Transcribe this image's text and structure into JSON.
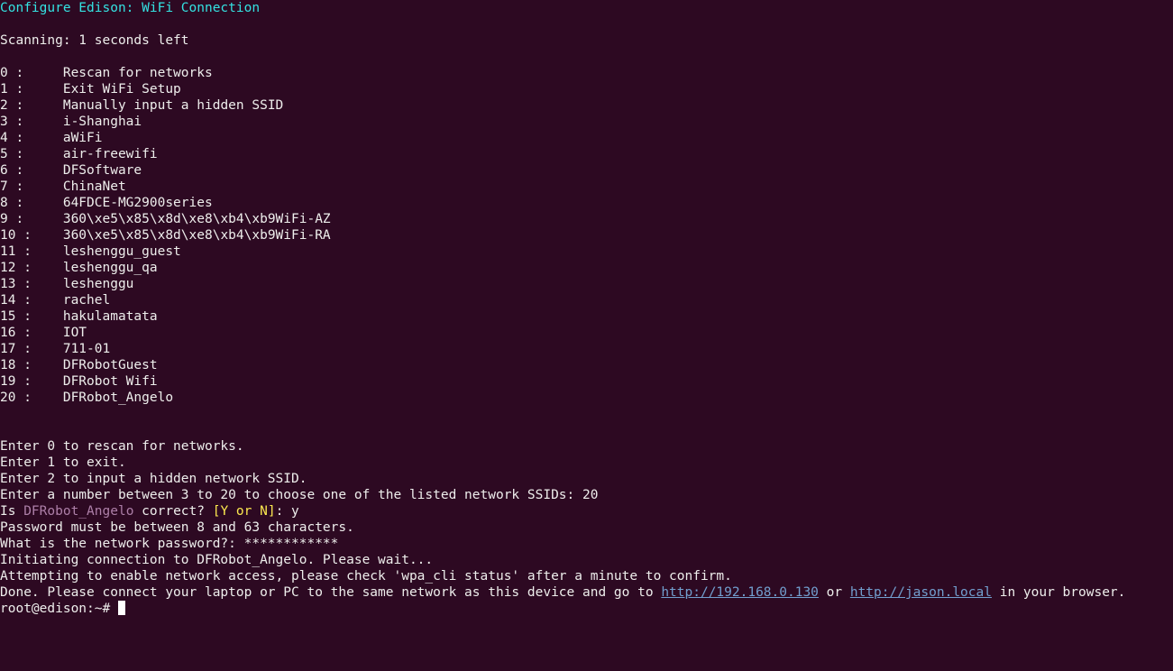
{
  "title": "Configure Edison: WiFi Connection",
  "scan_line": "Scanning: 1 seconds left",
  "options": [
    {
      "idx": "0 :     ",
      "label": "Rescan for networks"
    },
    {
      "idx": "1 :     ",
      "label": "Exit WiFi Setup"
    },
    {
      "idx": "2 :     ",
      "label": "Manually input a hidden SSID"
    },
    {
      "idx": "3 :     ",
      "label": "i-Shanghai"
    },
    {
      "idx": "4 :     ",
      "label": "aWiFi"
    },
    {
      "idx": "5 :     ",
      "label": "air-freewifi"
    },
    {
      "idx": "6 :     ",
      "label": "DFSoftware"
    },
    {
      "idx": "7 :     ",
      "label": "ChinaNet"
    },
    {
      "idx": "8 :     ",
      "label": "64FDCE-MG2900series"
    },
    {
      "idx": "9 :     ",
      "label": "360\\xe5\\x85\\x8d\\xe8\\xb4\\xb9WiFi-AZ"
    },
    {
      "idx": "10 :    ",
      "label": "360\\xe5\\x85\\x8d\\xe8\\xb4\\xb9WiFi-RA"
    },
    {
      "idx": "11 :    ",
      "label": "leshenggu_guest"
    },
    {
      "idx": "12 :    ",
      "label": "leshenggu_qa"
    },
    {
      "idx": "13 :    ",
      "label": "leshenggu"
    },
    {
      "idx": "14 :    ",
      "label": "rachel"
    },
    {
      "idx": "15 :    ",
      "label": "hakulamatata"
    },
    {
      "idx": "16 :    ",
      "label": "IOT"
    },
    {
      "idx": "17 :    ",
      "label": "711-01"
    },
    {
      "idx": "18 :    ",
      "label": "DFRobotGuest"
    },
    {
      "idx": "19 :    ",
      "label": "DFRobot Wifi"
    },
    {
      "idx": "20 :    ",
      "label": "DFRobot_Angelo"
    }
  ],
  "instr": {
    "l0": "Enter 0 to rescan for networks.",
    "l1": "Enter 1 to exit.",
    "l2": "Enter 2 to input a hidden network SSID.",
    "l3": "Enter a number between 3 to 20 to choose one of the listed network SSIDs: 20"
  },
  "confirm": {
    "pre": "Is ",
    "ssid": "DFRobot_Angelo",
    "mid": " correct? ",
    "yn": "[Y or N]",
    "post": ": y"
  },
  "pw_rule": "Password must be between 8 and 63 characters.",
  "pw_prompt": "What is the network password?: ************",
  "init_line": "Initiating connection to DFRobot_Angelo. Please wait...",
  "attempt_line": "Attempting to enable network access, please check 'wpa_cli status' after a minute to confirm.",
  "done": {
    "pre": "Done. Please connect your laptop or PC to the same network as this device and go to ",
    "url1": "http://192.168.0.130",
    "mid": " or ",
    "url2": "http://jason.local",
    "post": " in your browser."
  },
  "prompt": "root@edison:~# "
}
